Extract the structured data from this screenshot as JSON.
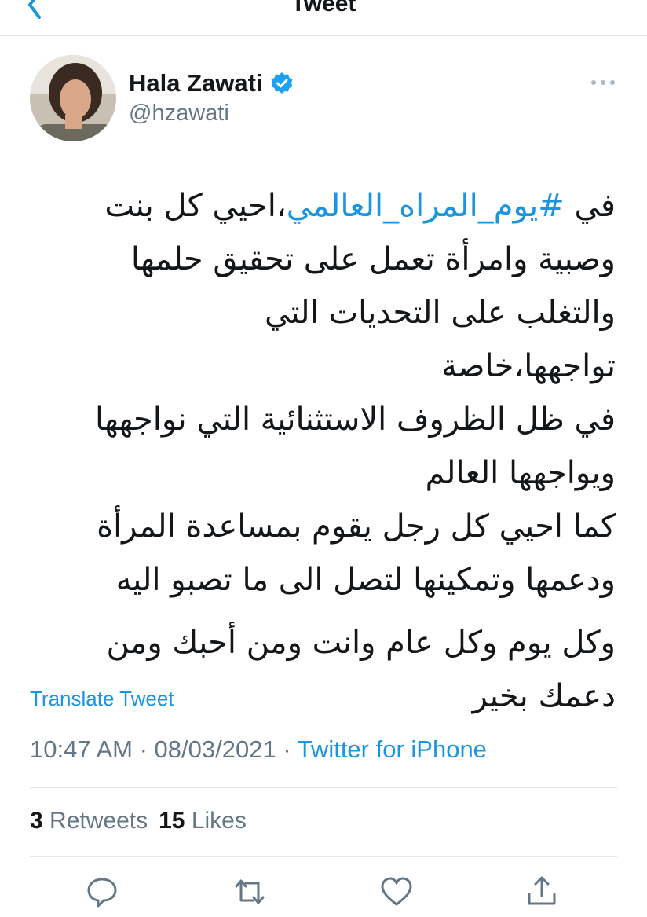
{
  "header": {
    "title": "Tweet"
  },
  "author": {
    "display_name": "Hala Zawati",
    "handle": "@hzawati",
    "verified": true
  },
  "tweet": {
    "hashtag": "#يوم_المراه_العالمي",
    "line1_prefix": "في ",
    "line1_suffix": "،احيي كل بنت",
    "lines": [
      "وصبية وامرأة تعمل على تحقيق حلمها",
      "والتغلب على التحديات التي تواجهها،خاصة",
      "في ظل الظروف الاستثنائية التي نواجهها",
      "ويواجهها العالم",
      "كما احيي كل رجل يقوم بمساعدة المرأة",
      "ودعمها وتمكينها لتصل الى ما تصبو اليه"
    ],
    "closing": [
      "وكل يوم وكل عام وانت ومن أحبك ومن",
      "دعمك بخير"
    ],
    "translate_label": "Translate Tweet",
    "time": "10:47 AM",
    "date": "08/03/2021",
    "separator": " · ",
    "source": "Twitter for iPhone"
  },
  "stats": {
    "retweets_count": "3",
    "retweets_label": "Retweets",
    "likes_count": "15",
    "likes_label": "Likes"
  },
  "actions": {
    "icons": [
      "reply-icon",
      "retweet-icon",
      "like-icon",
      "share-icon"
    ]
  },
  "colors": {
    "accent": "#1b95e0",
    "secondary_text": "#657786",
    "divider": "#e1e8ed"
  }
}
